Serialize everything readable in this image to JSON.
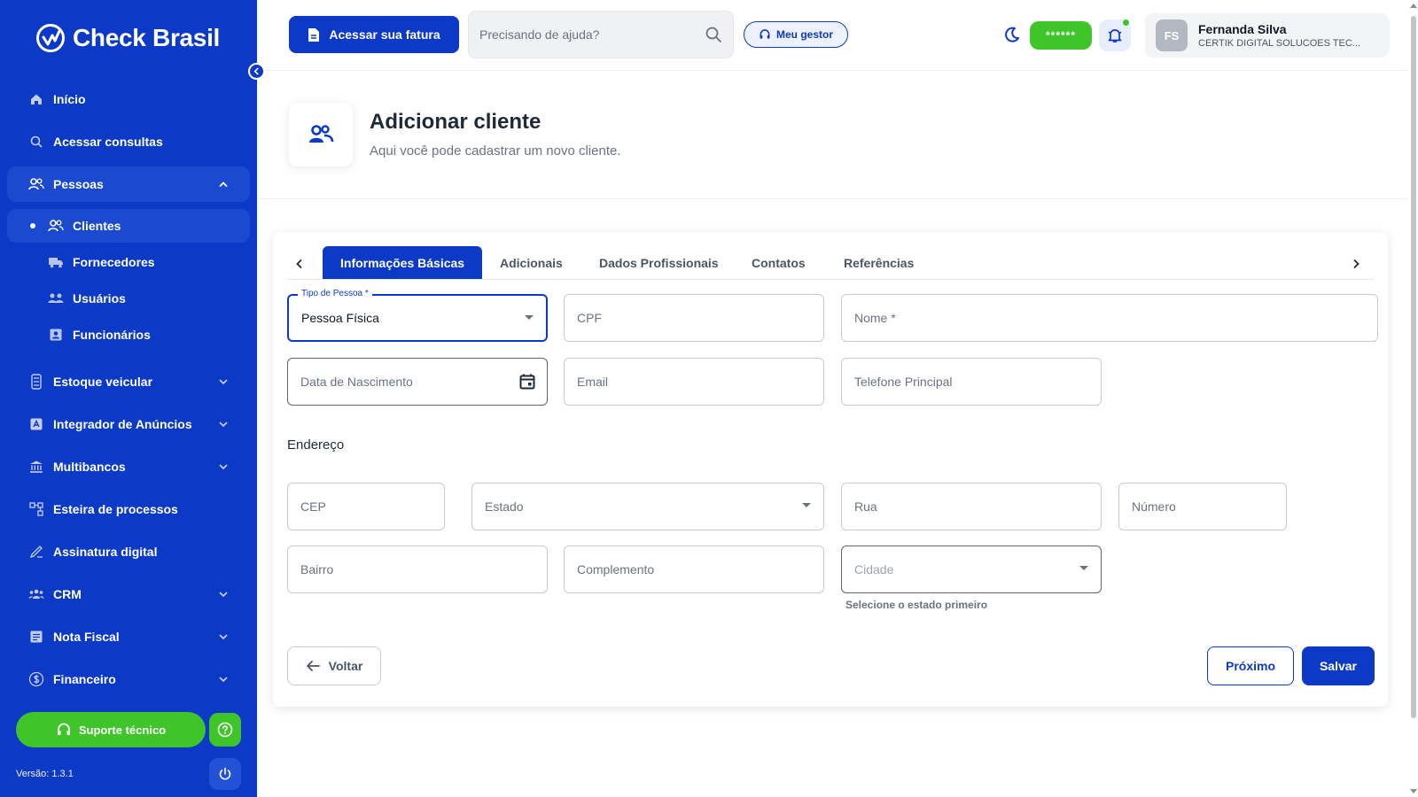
{
  "brand": {
    "name": "Check Brasil"
  },
  "sidebar": {
    "items": [
      {
        "label": "Início",
        "icon": "home-icon"
      },
      {
        "label": "Acessar consultas",
        "icon": "search-icon"
      },
      {
        "label": "Pessoas",
        "icon": "people-icon"
      },
      {
        "label": "Estoque veicular",
        "icon": "vehicle-icon"
      },
      {
        "label": "Integrador de Anúncios",
        "icon": "ads-icon"
      },
      {
        "label": "Multibancos",
        "icon": "bank-icon"
      },
      {
        "label": "Esteira de processos",
        "icon": "process-icon"
      },
      {
        "label": "Assinatura digital",
        "icon": "signature-icon"
      },
      {
        "label": "CRM",
        "icon": "crm-icon"
      },
      {
        "label": "Nota Fiscal",
        "icon": "invoice-icon"
      },
      {
        "label": "Financeiro",
        "icon": "finance-icon"
      }
    ],
    "subitems": [
      {
        "label": "Clientes",
        "icon": "clients-icon"
      },
      {
        "label": "Fornecedores",
        "icon": "truck-icon"
      },
      {
        "label": "Usuários",
        "icon": "users-icon"
      },
      {
        "label": "Funcionários",
        "icon": "badge-icon"
      }
    ],
    "support_label": "Suporte técnico",
    "version": "Versão: 1.3.1"
  },
  "header": {
    "fatura_label": "Acessar sua fatura",
    "search_placeholder": "Precisando de ajuda?",
    "gestor_label": "Meu gestor",
    "pill_label": "******",
    "user": {
      "initials": "FS",
      "name": "Fernanda Silva",
      "company": "CERTIK DIGITAL SOLUCOES TEC..."
    }
  },
  "page": {
    "title": "Adicionar cliente",
    "subtitle": "Aqui você pode cadastrar um novo cliente."
  },
  "tabs": [
    "Informações Básicas",
    "Adicionais",
    "Dados Profissionais",
    "Contatos",
    "Referências"
  ],
  "form": {
    "tipo_label": "Tipo de Pessoa *",
    "tipo_value": "Pessoa Física",
    "cpf": "CPF",
    "nome": "Nome *",
    "nascimento": "Data de Nascimento",
    "email": "Email",
    "telefone": "Telefone Principal",
    "endereco_title": "Endereço",
    "cep": "CEP",
    "estado": "Estado",
    "rua": "Rua",
    "numero": "Número",
    "bairro": "Bairro",
    "complemento": "Complemento",
    "cidade": "Cidade",
    "cidade_hint": "Selecione o estado primeiro"
  },
  "actions": {
    "voltar": "Voltar",
    "proximo": "Próximo",
    "salvar": "Salvar"
  },
  "colors": {
    "primary": "#0c3ac6",
    "success": "#3fc52a"
  }
}
